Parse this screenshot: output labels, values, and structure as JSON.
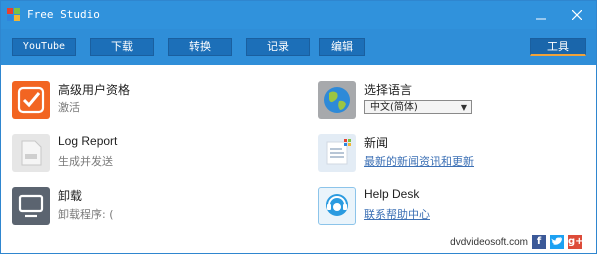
{
  "window": {
    "title": "Free Studio"
  },
  "toolbar": {
    "tabs": [
      {
        "label": "YouTube"
      },
      {
        "label": "下载"
      },
      {
        "label": "转换"
      },
      {
        "label": "记录"
      },
      {
        "label": "编辑"
      }
    ],
    "active_tab": {
      "label": "工具"
    }
  },
  "items": {
    "premium": {
      "title": "高级用户资格",
      "subtitle": "激活"
    },
    "language": {
      "title": "选择语言",
      "selected": "中文(简体)"
    },
    "log_report": {
      "title": "Log Report",
      "subtitle": "生成并发送"
    },
    "news": {
      "title": "新闻",
      "subtitle": "最新的新闻资讯和更新"
    },
    "uninstall": {
      "title": "卸载",
      "subtitle": "卸载程序: ("
    },
    "help_desk": {
      "title": "Help Desk",
      "subtitle": "联系帮助中心"
    }
  },
  "footer": {
    "site": "dvdvideosoft.com"
  },
  "colors": {
    "titlebar": "#3092dc",
    "toolbar": "#2f8ed8",
    "button": "#1c6fb8",
    "accent_orange": "#f0a23a",
    "link": "#3c70b5"
  }
}
